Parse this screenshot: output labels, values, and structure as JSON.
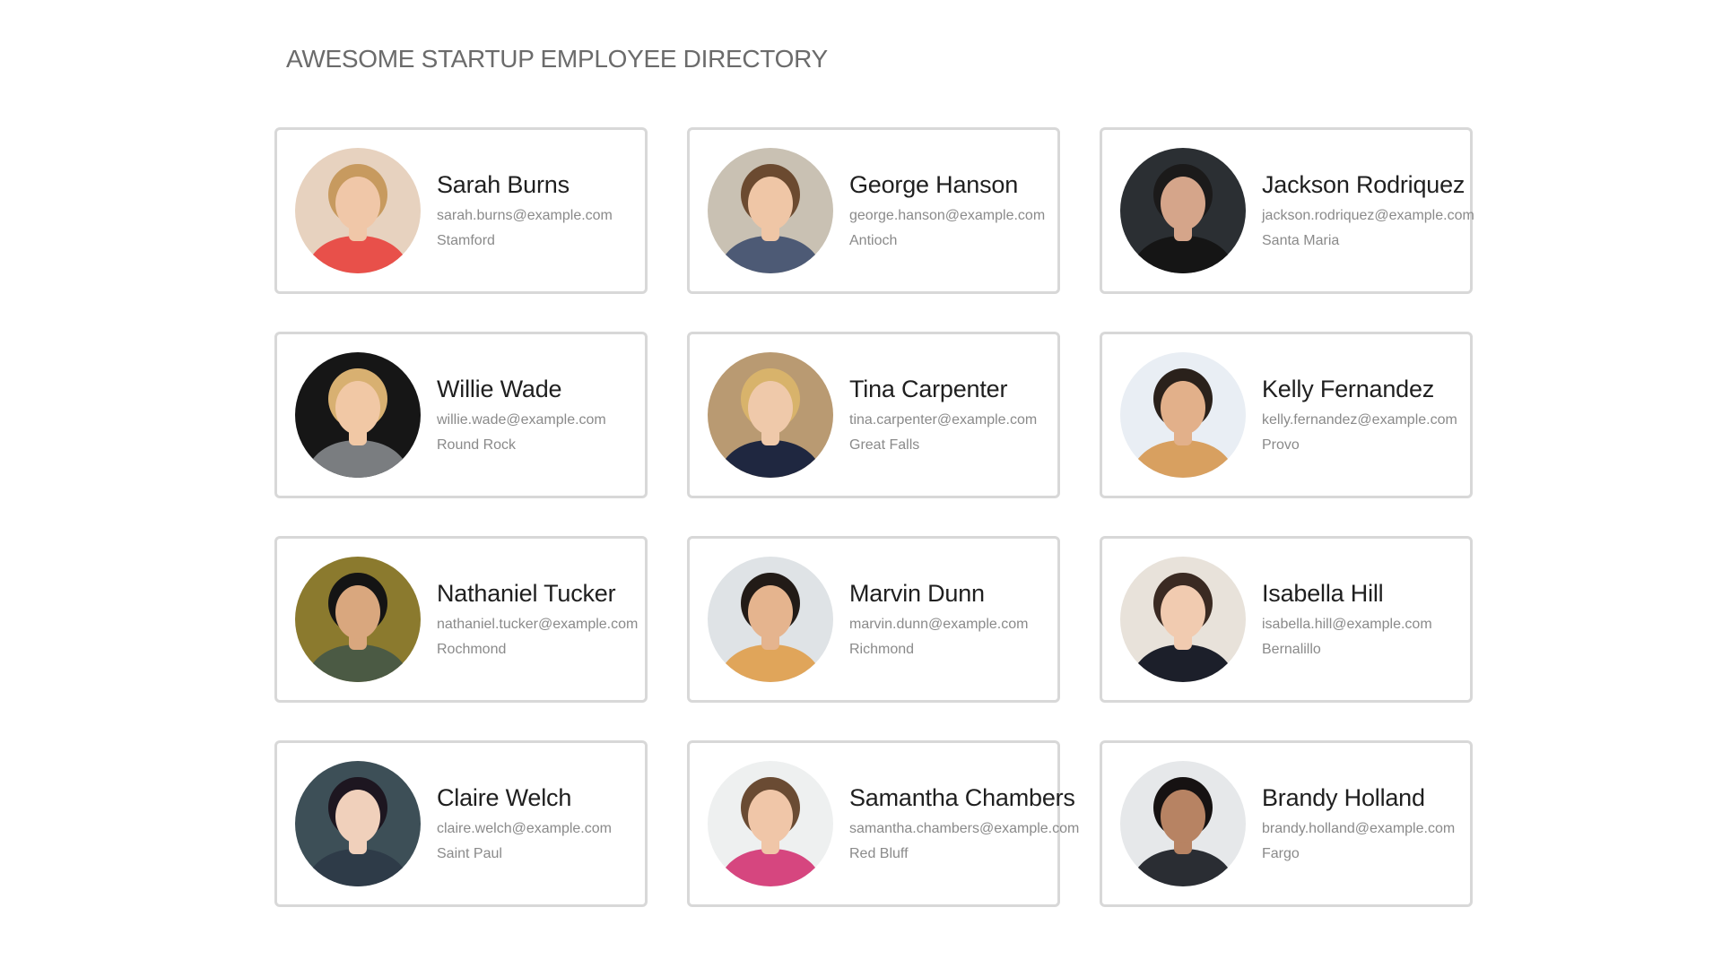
{
  "page": {
    "title": "AWESOME STARTUP EMPLOYEE DIRECTORY"
  },
  "employees": [
    {
      "name": "Sarah Burns",
      "email": "sarah.burns@example.com",
      "city": "Stamford",
      "photo": {
        "bg": "#e7d2bf",
        "skin": "#f0c7a8",
        "hair": "#c79a5f",
        "shirt": "#e8504a"
      }
    },
    {
      "name": "George Hanson",
      "email": "george.hanson@example.com",
      "city": "Antioch",
      "photo": {
        "bg": "#c9c1b3",
        "skin": "#efc6a6",
        "hair": "#6b4a30",
        "shirt": "#4d5a75"
      }
    },
    {
      "name": "Jackson Rodriquez",
      "email": "jackson.rodriquez@example.com",
      "city": "Santa Maria",
      "photo": {
        "bg": "#2b2f33",
        "skin": "#d5a58a",
        "hair": "#1b1a1a",
        "shirt": "#151515"
      }
    },
    {
      "name": "Willie Wade",
      "email": "willie.wade@example.com",
      "city": "Round Rock",
      "photo": {
        "bg": "#161616",
        "skin": "#f1c8a5",
        "hair": "#d8b071",
        "shirt": "#7a7d80"
      }
    },
    {
      "name": "Tina Carpenter",
      "email": "tina.carpenter@example.com",
      "city": "Great Falls",
      "photo": {
        "bg": "#b99a72",
        "skin": "#efc9aa",
        "hair": "#d8b36b",
        "shirt": "#1f2740"
      }
    },
    {
      "name": "Kelly Fernandez",
      "email": "kelly.fernandez@example.com",
      "city": "Provo",
      "photo": {
        "bg": "#e9eef4",
        "skin": "#e2b08a",
        "hair": "#2a211b",
        "shirt": "#d8a060"
      }
    },
    {
      "name": "Nathaniel Tucker",
      "email": "nathaniel.tucker@example.com",
      "city": "Rochmond",
      "photo": {
        "bg": "#8b7a2e",
        "skin": "#d9a77e",
        "hair": "#141414",
        "shirt": "#4b5a44"
      }
    },
    {
      "name": "Marvin Dunn",
      "email": "marvin.dunn@example.com",
      "city": "Richmond",
      "photo": {
        "bg": "#dfe3e6",
        "skin": "#e5b48e",
        "hair": "#221b17",
        "shirt": "#e0a55a"
      }
    },
    {
      "name": "Isabella Hill",
      "email": "isabella.hill@example.com",
      "city": "Bernalillo",
      "photo": {
        "bg": "#e8e2da",
        "skin": "#f1cbb0",
        "hair": "#3a2a22",
        "shirt": "#1c1f2a"
      }
    },
    {
      "name": "Claire Welch",
      "email": "claire.welch@example.com",
      "city": "Saint Paul",
      "photo": {
        "bg": "#3d4f57",
        "skin": "#f0d0bb",
        "hair": "#1d1620",
        "shirt": "#2e3b48"
      }
    },
    {
      "name": "Samantha Chambers",
      "email": "samantha.chambers@example.com",
      "city": "Red Bluff",
      "photo": {
        "bg": "#eef0f0",
        "skin": "#f0c6a8",
        "hair": "#6a4b33",
        "shirt": "#d6467f"
      }
    },
    {
      "name": "Brandy Holland",
      "email": "brandy.holland@example.com",
      "city": "Fargo",
      "photo": {
        "bg": "#e6e8ea",
        "skin": "#b78363",
        "hair": "#161212",
        "shirt": "#2a2d33"
      }
    }
  ],
  "colors": {
    "card_border": "#d8d8d8",
    "title_text": "#6b6b6b",
    "name_text": "#1f1f1f",
    "meta_text": "#8a8a8a"
  }
}
